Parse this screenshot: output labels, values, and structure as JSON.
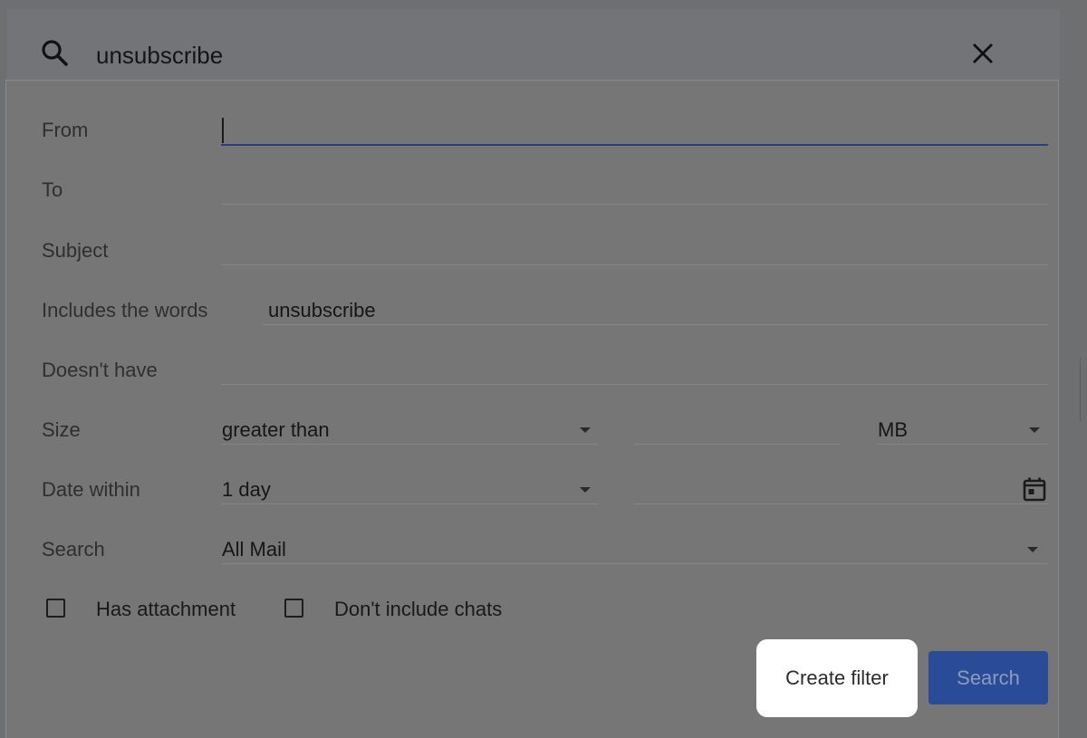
{
  "search_bar": {
    "query": "unsubscribe"
  },
  "form": {
    "from_label": "From",
    "from_value": "",
    "to_label": "To",
    "to_value": "",
    "subject_label": "Subject",
    "subject_value": "",
    "includes_label": "Includes the words",
    "includes_value": "unsubscribe",
    "doesnt_have_label": "Doesn't have",
    "doesnt_have_value": "",
    "size_label": "Size",
    "size_comparator": "greater than",
    "size_value": "",
    "size_unit": "MB",
    "date_label": "Date within",
    "date_range": "1 day",
    "date_value": "",
    "search_label": "Search",
    "search_scope": "All Mail",
    "has_attachment_label": "Has attachment",
    "has_attachment_checked": false,
    "dont_include_chats_label": "Don't include chats",
    "dont_include_chats_checked": false
  },
  "actions": {
    "create_filter_label": "Create filter",
    "search_label": "Search"
  },
  "icons": {
    "search": "search-icon",
    "close": "close-icon",
    "dropdown": "chevron-down-icon",
    "calendar": "calendar-icon"
  },
  "colors": {
    "overlay": "#6e6f71",
    "panel": "#767676",
    "accent_blue": "#2a4c98",
    "active_underline": "#2b3f7a",
    "highlight": "#ffffff"
  }
}
